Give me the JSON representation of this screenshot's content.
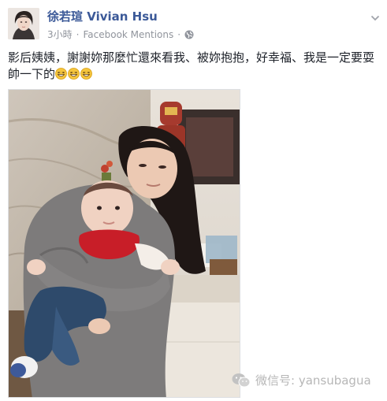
{
  "post": {
    "author": "徐若瑄 Vivian Hsu",
    "time": "3小時",
    "dot": "·",
    "source": "Facebook Mentions",
    "text": "影后姨姨，謝謝妳那麼忙還來看我、被妳抱抱，好幸福、我是一定要耍帥一下的",
    "emoji_count": 3
  },
  "watermark": {
    "text": "微信号: yansubagua"
  },
  "colors": {
    "author": "#3b5998",
    "meta": "#90949c",
    "text": "#1d2129",
    "watermark": "#b7b7b7"
  },
  "icons": {
    "privacy": "globe-icon",
    "menu": "chevron-down-icon",
    "emoji": "grinning-emoji-icon",
    "watermark": "wechat-icon"
  }
}
